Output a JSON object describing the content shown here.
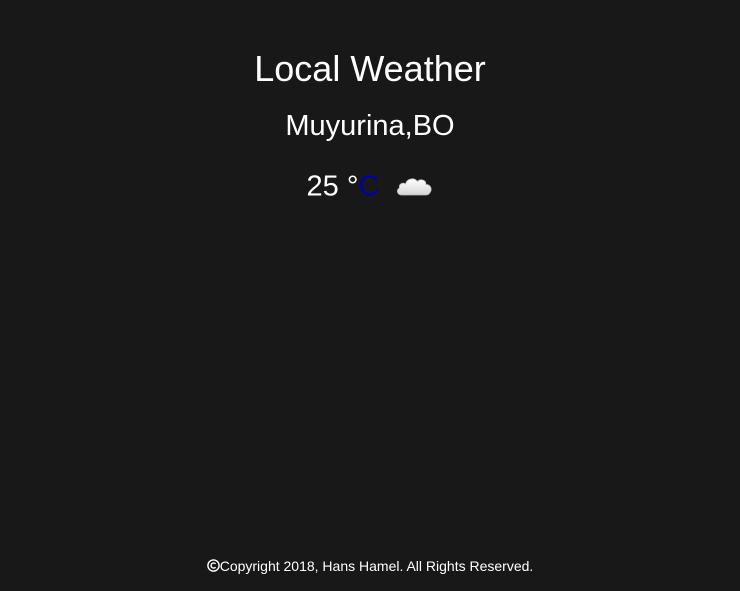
{
  "header": {
    "title": "Local Weather"
  },
  "weather": {
    "location": "Muyurina,BO",
    "temperature": "25",
    "degree_symbol": "°",
    "unit": "C",
    "condition_icon": "cloud-icon"
  },
  "footer": {
    "copyright_icon": "copyright-icon",
    "text": "Copyright 2018, Hans Hamel. All Rights Reserved."
  },
  "colors": {
    "background": "#181818",
    "text": "#ffffff",
    "unit_link": "#0000aa"
  }
}
